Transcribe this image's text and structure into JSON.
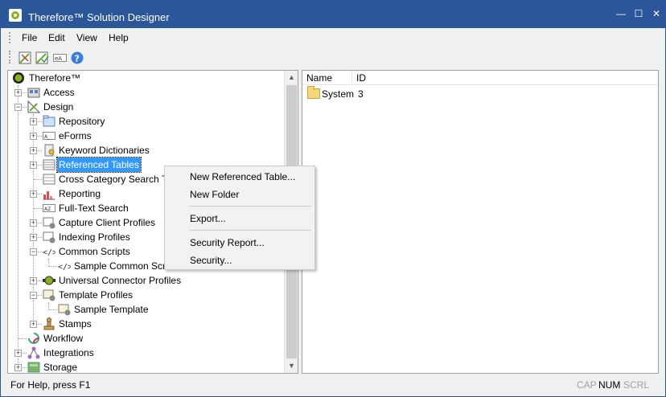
{
  "window": {
    "title": "Therefore™ Solution Designer",
    "controls": {
      "minimize": "—",
      "maximize": "☐",
      "close": "✕"
    }
  },
  "menubar": {
    "items": [
      {
        "label": "File"
      },
      {
        "label": "Edit"
      },
      {
        "label": "View"
      },
      {
        "label": "Help"
      }
    ]
  },
  "toolbar": {
    "buttons": [
      {
        "icon": "design-wand-icon"
      },
      {
        "icon": "design-check-icon"
      },
      {
        "icon": "eform-abc-icon"
      },
      {
        "icon": "help-icon",
        "label": "?"
      }
    ]
  },
  "tree": {
    "root": "Therefore™",
    "nodes": [
      {
        "label": "Access",
        "icon": "access-icon",
        "level": 1
      },
      {
        "label": "Design",
        "icon": "design-icon",
        "level": 1
      },
      {
        "label": "Repository",
        "icon": "repository-icon",
        "level": 2
      },
      {
        "label": "eForms",
        "icon": "eforms-icon",
        "level": 2
      },
      {
        "label": "Keyword Dictionaries",
        "icon": "keyword-dictionary-icon",
        "level": 2
      },
      {
        "label": "Referenced Tables",
        "icon": "referenced-table-icon",
        "level": 2,
        "selected": true
      },
      {
        "label": "Cross Category Search Te",
        "icon": "cross-category-icon",
        "level": 2
      },
      {
        "label": "Reporting",
        "icon": "reporting-icon",
        "level": 2
      },
      {
        "label": "Full-Text Search",
        "icon": "full-text-search-icon",
        "level": 2
      },
      {
        "label": "Capture Client Profiles",
        "icon": "capture-profile-icon",
        "level": 2
      },
      {
        "label": "Indexing Profiles",
        "icon": "indexing-profile-icon",
        "level": 2
      },
      {
        "label": "Common Scripts",
        "icon": "script-icon",
        "level": 2
      },
      {
        "label": "Sample Common Scr",
        "icon": "script-icon",
        "level": 3
      },
      {
        "label": "Universal Connector Profiles",
        "icon": "connector-icon",
        "level": 2
      },
      {
        "label": "Template Profiles",
        "icon": "template-profile-icon",
        "level": 2
      },
      {
        "label": "Sample Template",
        "icon": "template-icon",
        "level": 3
      },
      {
        "label": "Stamps",
        "icon": "stamp-icon",
        "level": 2
      },
      {
        "label": "Workflow",
        "icon": "workflow-icon",
        "level": 1
      },
      {
        "label": "Integrations",
        "icon": "integrations-icon",
        "level": 1
      },
      {
        "label": "Storage",
        "icon": "storage-icon",
        "level": 1
      }
    ]
  },
  "list": {
    "columns": [
      "Name",
      "ID"
    ],
    "rows": [
      {
        "name": "System",
        "id": "3"
      }
    ]
  },
  "context_menu": {
    "items": [
      "New Referenced Table...",
      "New Folder",
      "Export...",
      "Security Report...",
      "Security..."
    ]
  },
  "status": {
    "help": "For Help, press F1",
    "cap": "CAP",
    "num": "NUM",
    "scrl": "SCRL"
  },
  "colors": {
    "accent": "#2b579a",
    "selection": "#3399ff"
  }
}
